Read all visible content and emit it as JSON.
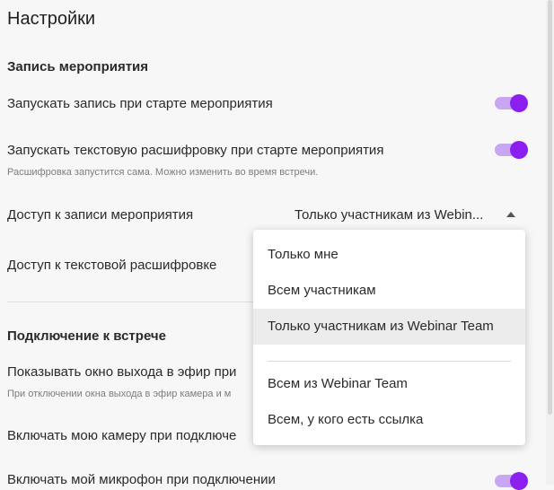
{
  "title": "Настройки",
  "recording": {
    "section": "Запись мероприятия",
    "auto_record": {
      "label": "Запускать запись при старте мероприятия",
      "on": true
    },
    "auto_transcript": {
      "label": "Запускать текстовую расшифровку при старте мероприятия",
      "hint": "Расшифровка запустится сама. Можно изменить во время встречи.",
      "on": true
    },
    "access": {
      "label": "Доступ к записи мероприятия",
      "value": "Только участникам из Webin..."
    },
    "transcript_access": {
      "label": "Доступ к текстовой расшифровке"
    }
  },
  "connection": {
    "section": "Подключение к встрече",
    "show_window": {
      "label": "Показывать окно выхода в эфир при",
      "hint": "При отключении окна выхода в эфир камера и м"
    },
    "camera": {
      "label": "Включать мою камеру при подключе"
    },
    "microphone": {
      "label": "Включать мой микрофон при подключении",
      "on": true
    }
  },
  "dropdown": {
    "options": [
      {
        "label": "Только мне"
      },
      {
        "label": "Всем участникам"
      },
      {
        "label": "Только участникам из Webinar Team",
        "selected": true
      },
      {
        "label": "Всем из Webinar Team"
      },
      {
        "label": "Всем, у кого есть ссылка"
      }
    ]
  },
  "colors": {
    "accent": "#8a1ff0",
    "accent_track": "#c9a6f2"
  }
}
